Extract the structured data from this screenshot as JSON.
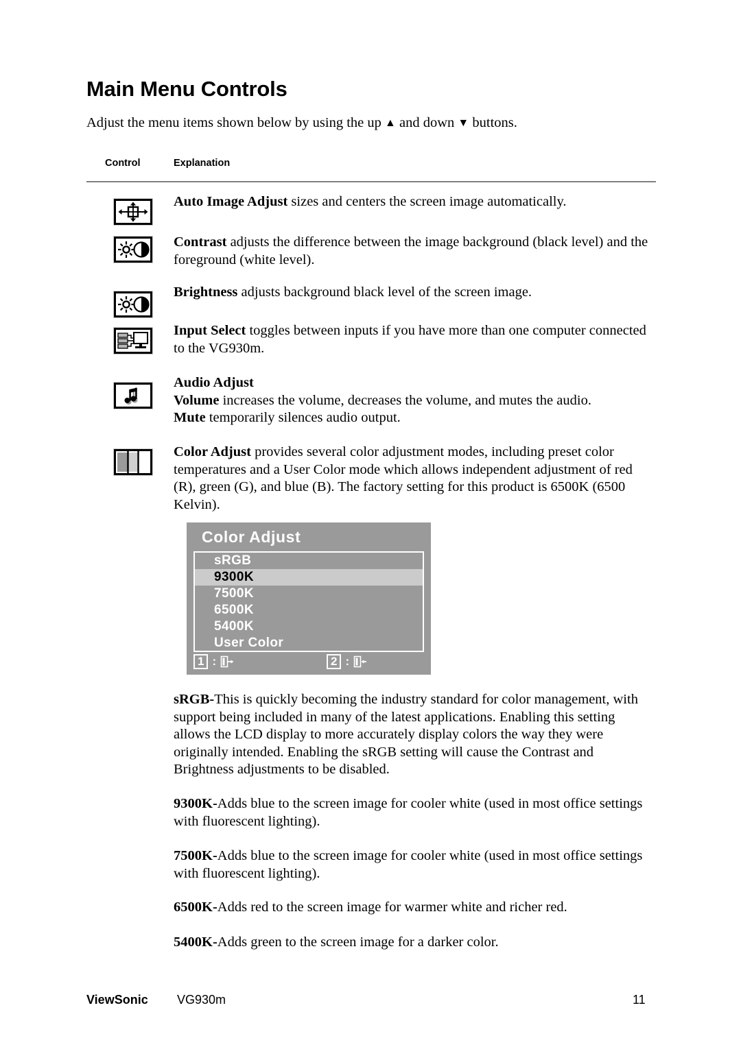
{
  "page": {
    "title": "Main Menu Controls",
    "intro_before": "Adjust the menu items shown below by using the up ",
    "intro_up": "▲",
    "intro_mid": " and down ",
    "intro_down": "▼",
    "intro_after": " buttons."
  },
  "table": {
    "header_control": "Control",
    "header_explanation": "Explanation"
  },
  "rows": [
    {
      "icon": "auto-image-adjust-icon",
      "term": "Auto Image Adjust",
      "text": " sizes and centers the screen image automatically."
    },
    {
      "icon": "contrast-icon",
      "term": "Contrast",
      "text": " adjusts the difference between the image background  (black level) and the foreground (white level)."
    },
    {
      "icon": "brightness-icon",
      "term": "Brightness",
      "text": " adjusts background black level of the screen image."
    },
    {
      "icon": "input-select-icon",
      "term": "Input Select",
      "text": " toggles between inputs if you have more than one computer connected to the VG930m."
    },
    {
      "icon": "audio-adjust-icon",
      "heading": "Audio Adjust",
      "term": "Volume",
      "text": " increases the volume, decreases the volume, and mutes the audio.",
      "term2": "Mute",
      "text2": " temporarily silences audio output."
    },
    {
      "icon": "color-adjust-icon",
      "term": "Color Adjust",
      "text": " provides several color adjustment modes, including preset color temperatures and a User Color mode which allows independent adjustment of red (R), green (G), and blue (B). The factory setting for this product is 6500K (6500 Kelvin)."
    }
  ],
  "osd": {
    "title": "Color Adjust",
    "items": [
      {
        "label": "sRGB",
        "selected": false
      },
      {
        "label": "9300K",
        "selected": true
      },
      {
        "label": "7500K",
        "selected": false
      },
      {
        "label": "6500K",
        "selected": false
      },
      {
        "label": "5400K",
        "selected": false
      },
      {
        "label": "User Color",
        "selected": false
      }
    ],
    "footer": {
      "btn1_num": "1",
      "btn1_colon": ":",
      "btn1_icon": "exit-right-icon",
      "btn2_num": "2",
      "btn2_colon": ":",
      "btn2_icon": "exit-left-icon"
    },
    "colors": {
      "panel_bg": "#9a9a9a",
      "selected_bg": "#cbcbcb",
      "item_text": "#ffffff",
      "selected_text": "#000000"
    }
  },
  "descriptions": [
    {
      "term": "sRGB-",
      "text": "This is quickly becoming the industry standard for color management, with support being included in many of the latest applications. Enabling this setting allows the LCD display to more accurately display colors the way they were originally intended. Enabling the sRGB setting will cause the Contrast and Brightness adjustments to be disabled."
    },
    {
      "term": "9300K-",
      "text": "Adds blue to the screen image for cooler white (used in most office settings with fluorescent lighting)."
    },
    {
      "term": "7500K-",
      "text": "Adds blue to the screen image for cooler white (used in most office settings with fluorescent lighting)."
    },
    {
      "term": "6500K-",
      "text": "Adds red to the screen image for warmer white and richer red."
    },
    {
      "term": "5400K-",
      "text": "Adds green to the screen image for a darker color."
    }
  ],
  "footer": {
    "brand": "ViewSonic",
    "model": "VG930m",
    "page_number": "11"
  }
}
